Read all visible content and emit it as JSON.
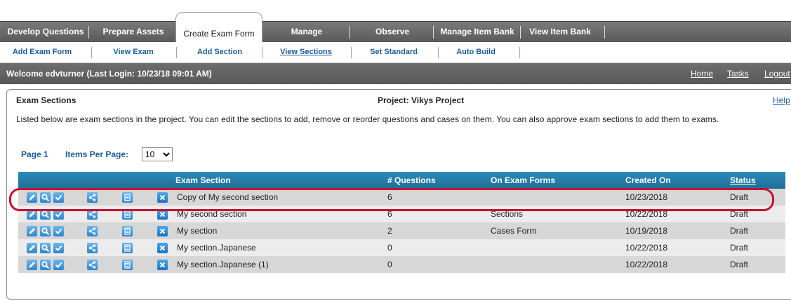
{
  "nav": {
    "tabs": [
      "Develop Questions",
      "Prepare Assets",
      "Create Exam Form",
      "Manage",
      "Observe",
      "Manage Item Bank",
      "View Item Bank"
    ],
    "active_tab": "Create Exam Form"
  },
  "subnav": {
    "items": [
      "Add Exam Form",
      "View Exam",
      "Add Section",
      "View Sections",
      "Set Standard",
      "Auto Build"
    ],
    "active_item": "View Sections"
  },
  "welcome": {
    "message": "Welcome edvturner (Last Login: 10/23/18   09:01 AM)",
    "links": [
      "Home",
      "Tasks",
      "Logout"
    ]
  },
  "panel": {
    "title": "Exam Sections",
    "project": "Project: Vikys Project",
    "help": "Help",
    "description": "Listed below are exam sections in the project. You can edit the sections to add, remove or reorder questions and cases on them. You can also approve exam sections to add them to exams."
  },
  "pager": {
    "page": "Page 1",
    "items_per_page_label": "Items Per Page:",
    "items_per_page_value": "10"
  },
  "table": {
    "headers": [
      "Exam Section",
      "# Questions",
      "On Exam Forms",
      "Created On",
      "Status"
    ],
    "rows": [
      {
        "section": "Copy of My second section",
        "questions": "6",
        "forms": "",
        "created": "10/23/2018",
        "status": "Draft"
      },
      {
        "section": "My second section",
        "questions": "6",
        "forms": "Sections",
        "created": "10/22/2018",
        "status": "Draft"
      },
      {
        "section": "My section",
        "questions": "2",
        "forms": "Cases Form",
        "created": "10/19/2018",
        "status": "Draft"
      },
      {
        "section": "My section.Japanese",
        "questions": "0",
        "forms": "",
        "created": "10/22/2018",
        "status": "Draft"
      },
      {
        "section": "My section.Japanese (1)",
        "questions": "0",
        "forms": "",
        "created": "10/22/2018",
        "status": "Draft"
      }
    ],
    "row_icons": [
      "edit-icon",
      "search-icon",
      "approve-check-icon",
      "share-icon",
      "notes-icon",
      "delete-icon"
    ]
  },
  "colors": {
    "nav_bg": "#666666",
    "table_header": "#2480ae",
    "link_blue": "#1a5a9a",
    "highlight": "#c8102e"
  }
}
